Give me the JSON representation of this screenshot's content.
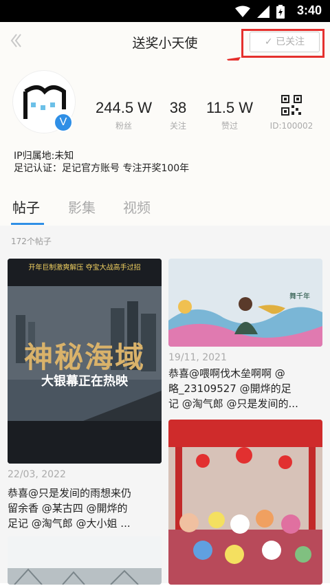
{
  "status": {
    "time": "3:40"
  },
  "header": {
    "back_icon": "chevron-left-icon",
    "title": "送奖小天使",
    "follow_label": "✓ 已关注"
  },
  "profile": {
    "stats": [
      {
        "value": "244.5 W",
        "label": "粉丝"
      },
      {
        "value": "38",
        "label": "关注"
      },
      {
        "value": "11.5 W",
        "label": "赞过"
      }
    ],
    "id_label": "ID:100002",
    "ip_line": "IP归属地:未知",
    "cert_line": "足记认证：足记官方账号  专注开奖100年",
    "badge": "V"
  },
  "tabs": [
    {
      "label": "帖子"
    },
    {
      "label": "影集"
    },
    {
      "label": "视频"
    }
  ],
  "posts": {
    "count_label": "172个帖子",
    "items": [
      {
        "banner": "开年巨制激爽解压  夺宝大战高手过招",
        "title_art": "神秘海域",
        "subtitle": "大银幕正在热映",
        "date": "22/03, 2022",
        "text1": "恭喜@只是发间的雨想来仍",
        "text2": "留余香 @某古四 @開烨的",
        "text3": "足记 @淘气郎 @大小姐 ..."
      },
      {
        "logo_text": "舞千年",
        "date": "19/11, 2021",
        "text1": "恭喜@喂啊伐木垒啊啊 @",
        "text2": "略_23109527 @開烨的足",
        "text3": "记 @淘气郎 @只是发间的..."
      }
    ]
  }
}
